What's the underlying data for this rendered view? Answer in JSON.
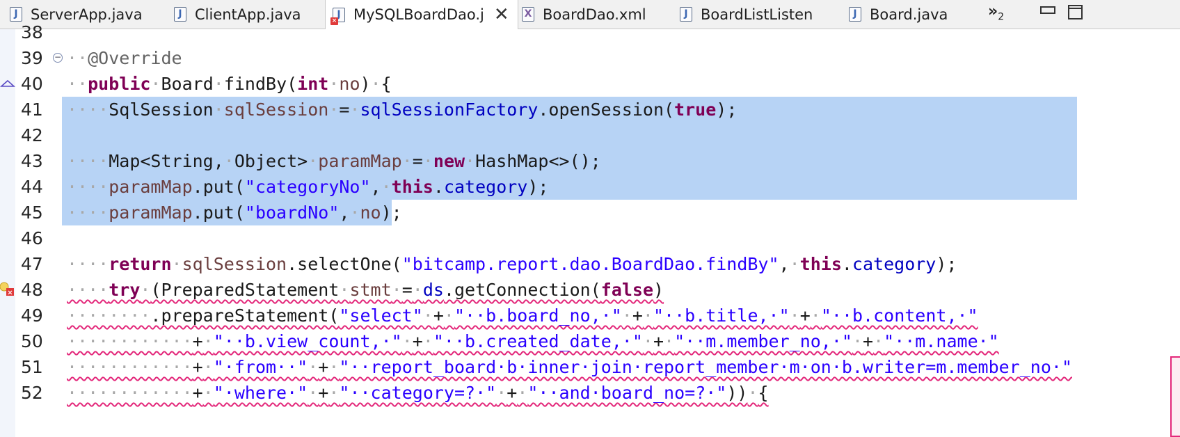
{
  "tabs": [
    {
      "label": "ServerApp.java",
      "icon": "java-file-icon",
      "active": false
    },
    {
      "label": "ClientApp.java",
      "icon": "java-file-icon",
      "active": false
    },
    {
      "label": "MySQLBoardDao.j",
      "icon": "java-file-error-icon",
      "active": true
    },
    {
      "label": "BoardDao.xml",
      "icon": "xml-file-icon",
      "active": false
    },
    {
      "label": "BoardListListen",
      "icon": "java-file-icon",
      "active": false
    },
    {
      "label": "Board.java",
      "icon": "java-file-icon",
      "active": false
    }
  ],
  "overflow": {
    "symbol": "»",
    "count": "2"
  },
  "icon_glyphs": {
    "java": "J",
    "xml": "X"
  },
  "lines": [
    {
      "n": "38",
      "text": ""
    },
    {
      "n": "39",
      "text": "@Override"
    },
    {
      "n": "40",
      "text": "public Board findBy(int no) {"
    },
    {
      "n": "41",
      "text": "SqlSession sqlSession = sqlSessionFactory.openSession(true);"
    },
    {
      "n": "42",
      "text": ""
    },
    {
      "n": "43",
      "text": "Map<String, Object> paramMap = new HashMap<>();"
    },
    {
      "n": "44",
      "text": "paramMap.put(\"categoryNo\", this.category);"
    },
    {
      "n": "45",
      "text": "paramMap.put(\"boardNo\", no);"
    },
    {
      "n": "46",
      "text": ""
    },
    {
      "n": "47",
      "text": "return sqlSession.selectOne(\"bitcamp.report.dao.BoardDao.findBy\", this.category);"
    },
    {
      "n": "48",
      "text": "try (PreparedStatement stmt = ds.getConnection(false)"
    },
    {
      "n": "49",
      "text": ".prepareStatement(\"select\" + \"  b.board_no, \" + \"  b.title, \" + \"  b.content, \""
    },
    {
      "n": "50",
      "text": "+ \"  b.view_count, \" + \"  b.created_date, \" + \"  m.member_no, \" + \"  m.name \""
    },
    {
      "n": "51",
      "text": "+ \" from  \" + \"  report_board b inner join report_member m on b.writer=m.member_no \""
    },
    {
      "n": "52",
      "text": "+ \" where \" + \"  category=? \" + \"  and board_no=? \")) {"
    }
  ],
  "colors": {
    "keyword": "#7f0055",
    "string": "#2a00ff",
    "field": "#0000c0",
    "local_var": "#6a3e3e",
    "annotation": "#646464",
    "selection": "#b7d3f5",
    "error_underline": "#e3277a"
  }
}
